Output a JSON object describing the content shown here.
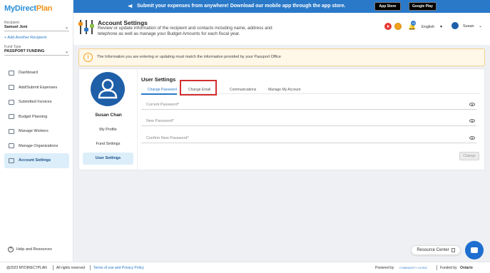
{
  "brand": {
    "logo_a": "My",
    "logo_b": "Direct",
    "logo_c": "Plan"
  },
  "sidebar": {
    "recipient_label": "Recipient",
    "recipient_value": "Samuel Joni",
    "add_recipient": "+ Add Another Recipient",
    "fund_label": "Fund Type",
    "fund_value": "PASSPORT FUNDING",
    "items": [
      {
        "label": "Dashboard",
        "icon": "dashboard-icon"
      },
      {
        "label": "Add/Submit Expenses",
        "icon": "expenses-icon"
      },
      {
        "label": "Submitted Invoices",
        "icon": "invoices-icon"
      },
      {
        "label": "Budget Planning",
        "icon": "budget-icon"
      },
      {
        "label": "Manage Workers",
        "icon": "workers-icon"
      },
      {
        "label": "Manage Organizations",
        "icon": "organizations-icon"
      },
      {
        "label": "Account Settings",
        "icon": "account-icon",
        "active": true
      }
    ],
    "help": "Help and Resources"
  },
  "banner": {
    "message": "Submit your expenses from anywhere! Download our mobile app through the app store.",
    "app_store": "App Store",
    "google_play": "Google Play",
    "color": "#2a79c9"
  },
  "header": {
    "title": "Account Settings",
    "description": "Review or update information of the recipient and contacts including name, address and telephone as well as manage your Budget Amounts for each fiscal year.",
    "notifications_count": "15",
    "language": "English",
    "user": "Susan"
  },
  "info": {
    "text": "The Information you are entering or updating must match the information provided by your Passport Office"
  },
  "profile": {
    "name": "Susan Chan",
    "links": [
      "My Profile",
      "Fund Settings",
      "User Settings"
    ]
  },
  "user_settings": {
    "title": "User Settings",
    "tabs": [
      "Change Password",
      "Change Email",
      "Communications",
      "Manage My Account"
    ],
    "fields": [
      "Current Password*",
      "New Password*",
      "Confirm New Password*"
    ],
    "change_button": "Change"
  },
  "footer": {
    "copyright": "@2023 MYDIRECTPLAN",
    "rights": "All rights reserved",
    "terms": "Terms of use and Privacy Policy",
    "powered_by": "Powered by",
    "community_living": "COMMUNITY LIVING",
    "funded_by": "Funded by",
    "ontario": "Ontario"
  },
  "resource_center": "Resource Center"
}
